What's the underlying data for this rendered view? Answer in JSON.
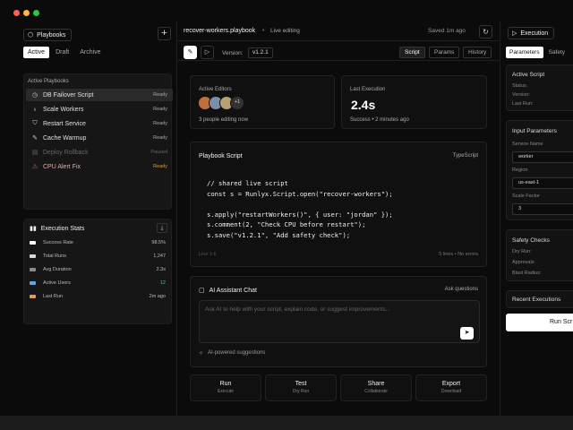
{
  "colors": {
    "traffic_red": "#ff5f57",
    "traffic_yellow": "#febc2e",
    "traffic_green": "#28c840",
    "stat_success_rate": "#ffffff",
    "stat_total_runs": "#d8d8d8",
    "stat_avg_duration": "#8a8a8a",
    "stat_active_users": "#5aa9e6",
    "stat_last_run": "#e59a4c",
    "ready_text": "#aaaaaa",
    "warn_status": "#e0a030",
    "active_users_value": "#4fc38a"
  },
  "sidebar": {
    "title": "Playbooks",
    "title_icon": "cube-icon",
    "add_icon": "plus-icon",
    "tabs": [
      "Active",
      "Draft",
      "Archive"
    ],
    "active_tab": "Active",
    "section_title": "Active Playbooks",
    "playbooks": [
      {
        "name": "DB Failover Script",
        "status": "Ready",
        "icon": "clock-icon",
        "selected": true
      },
      {
        "name": "Scale Workers",
        "status": "Ready",
        "icon": "bulb-icon"
      },
      {
        "name": "Restart Service",
        "status": "Ready",
        "icon": "shield-icon"
      },
      {
        "name": "Cache Warmup",
        "status": "Ready",
        "icon": "wrench-icon"
      },
      {
        "name": "Deploy Rollback",
        "status": "Paused",
        "icon": "doc-icon",
        "dim": true
      },
      {
        "name": "CPU Alert Fix",
        "status": "Ready",
        "icon": "warning-icon",
        "warn": true
      }
    ],
    "stats": {
      "title": "Execution Stats",
      "title_icon": "bar-chart-icon",
      "download_icon": "download-icon",
      "rows": [
        {
          "label": "Success Rate",
          "value": "98.5%"
        },
        {
          "label": "Total Runs",
          "value": "1,247"
        },
        {
          "label": "Avg Duration",
          "value": "2.3s"
        },
        {
          "label": "Active Users",
          "value": "12"
        },
        {
          "label": "Last Run",
          "value": "2m ago"
        }
      ]
    }
  },
  "header": {
    "file_name": "recover-workers.playbook",
    "live_label": "Live editing",
    "saved_label": "Saved 1m ago",
    "refresh_icon": "refresh-icon"
  },
  "toolbar": {
    "edit_icon": "edit-icon",
    "play_icon": "play-icon",
    "version_label": "Version:",
    "version_value": "v1.2.1",
    "tabs": [
      "Script",
      "Params",
      "History"
    ],
    "active_tab": "Script"
  },
  "editors": {
    "label": "Active Editors",
    "extra_count": "+1",
    "caption": "3 people editing now"
  },
  "last_execution": {
    "label": "Last Execution",
    "value": "2.4s",
    "caption": "Success • 2 minutes ago"
  },
  "script": {
    "title": "Playbook Script",
    "language": "TypeScript",
    "code_lines": [
      "// shared live script",
      "const s = Runlyx.Script.open(\"recover-workers\");",
      "",
      "s.apply(\"restartWorkers()\", { user: \"jordan\" });",
      "s.comment(2, \"Check CPU before restart\");",
      "s.save(\"v1.2.1\", \"Add safety check\");"
    ],
    "cursor_pos": "Line 1:6",
    "summary": "5 lines • No errors"
  },
  "chat": {
    "title": "AI Assistant Chat",
    "title_icon": "chat-icon",
    "ask_label": "Ask questions",
    "placeholder": "Ask AI to help with your script, explain code, or suggest improvements...",
    "send_icon": "send-icon",
    "suggestions_label": "AI-powered suggestions",
    "suggestions_icon": "sparkle-icon"
  },
  "actions": [
    {
      "label": "Run",
      "sub": "Execute"
    },
    {
      "label": "Test",
      "sub": "Dry Run"
    },
    {
      "label": "Share",
      "sub": "Collaborate"
    },
    {
      "label": "Export",
      "sub": "Download"
    }
  ],
  "right_panel": {
    "title": "Execution",
    "title_icon": "play-icon",
    "tabs": [
      "Parameters",
      "Safety"
    ],
    "active_tab": "Parameters",
    "active_script": {
      "title": "Active Script",
      "keys": [
        "Status:",
        "Version:",
        "Last Run:"
      ]
    },
    "inputs": {
      "title": "Input Parameters",
      "service_label": "Service Name",
      "service_value": "worker",
      "region_label": "Region",
      "region_value": "us-east-1",
      "scale_label": "Scale Factor",
      "scale_value": "3"
    },
    "safety": {
      "title": "Safety Checks",
      "keys": [
        "Dry Run:",
        "Approvals:",
        "Blast Radius:"
      ]
    },
    "recent_title": "Recent Executions",
    "run_button": "Run Scr"
  }
}
